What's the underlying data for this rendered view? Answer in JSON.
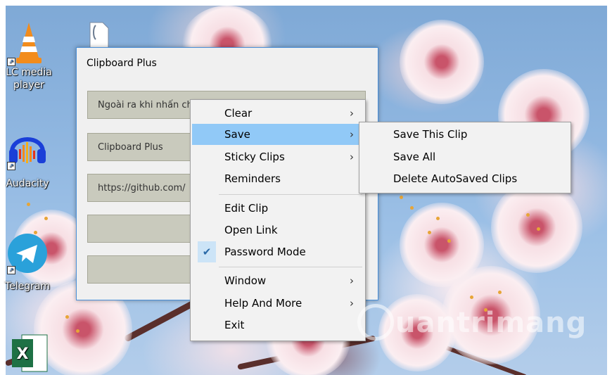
{
  "desktop": {
    "icons": [
      {
        "label_line1": "LC media",
        "label_line2": "player",
        "icon": "vlc-icon"
      },
      {
        "label_line1": "Audacity",
        "label_line2": "",
        "icon": "audacity-icon"
      },
      {
        "label_line1": "Telegram",
        "label_line2": "",
        "icon": "telegram-icon"
      },
      {
        "label_line1": "",
        "label_line2": "",
        "icon": "excel-icon"
      },
      {
        "label_line1": "",
        "label_line2": "",
        "icon": "document-icon"
      }
    ]
  },
  "clipboard_window": {
    "title": "Clipboard Plus",
    "clips": [
      "Ngoài ra khi nhấn ch",
      "Clipboard Plus",
      "https://github.com/",
      "",
      ""
    ]
  },
  "context_menu": {
    "items": [
      {
        "label": "Clear",
        "has_submenu": true
      },
      {
        "label": "Save",
        "has_submenu": true,
        "highlighted": true
      },
      {
        "label": "Sticky Clips",
        "has_submenu": true
      },
      {
        "label": "Reminders",
        "has_submenu": false
      },
      {
        "label": "Edit Clip",
        "has_submenu": false
      },
      {
        "label": "Open Link",
        "has_submenu": false
      },
      {
        "label": "Password Mode",
        "has_submenu": false,
        "checked": true
      },
      {
        "label": "Window",
        "has_submenu": true
      },
      {
        "label": "Help And More",
        "has_submenu": true
      },
      {
        "label": "Exit",
        "has_submenu": false
      }
    ],
    "arrow_glyph": "›",
    "check_glyph": "✔"
  },
  "save_submenu": {
    "items": [
      {
        "label": "Save This Clip"
      },
      {
        "label": "Save All"
      },
      {
        "label": "Delete AutoSaved Clips"
      }
    ]
  },
  "watermark": "uantrimang",
  "colors": {
    "highlight": "#91c9f7",
    "menu_bg": "#f2f2f2",
    "clip_bg": "#c9cabd",
    "window_border": "#4a90d9"
  }
}
